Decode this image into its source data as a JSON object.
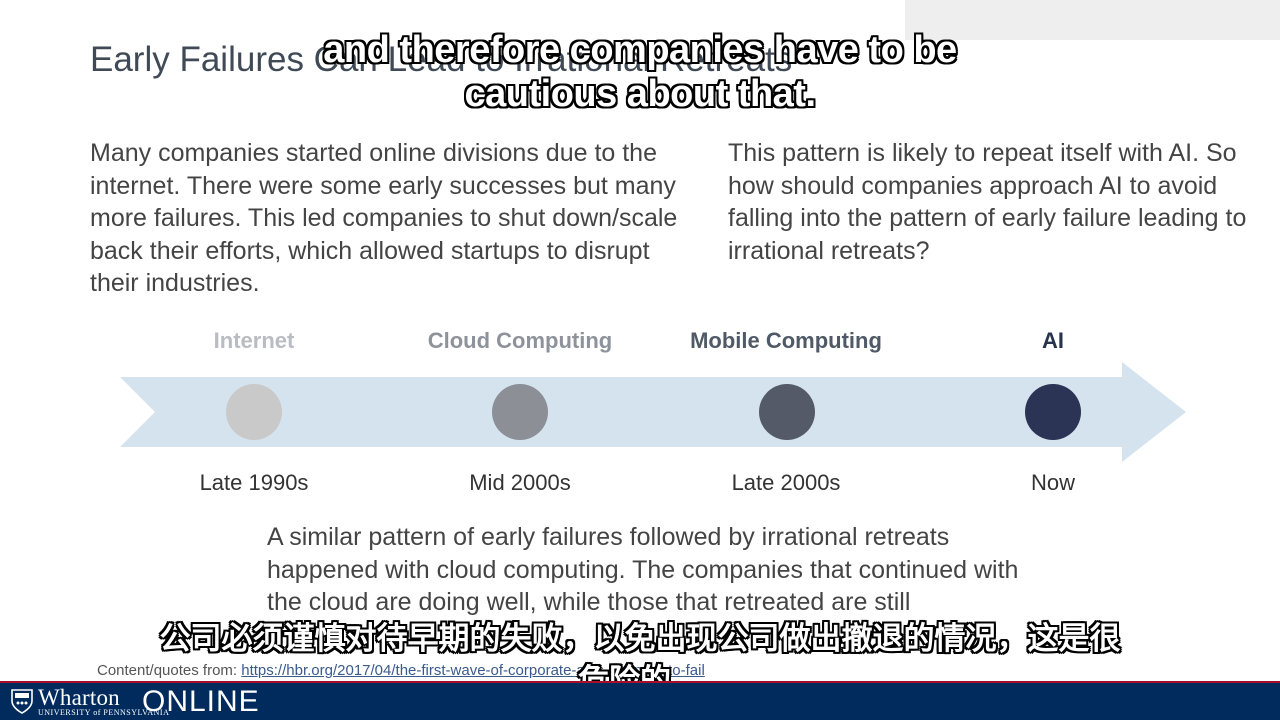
{
  "slide": {
    "title": "Early Failures Can Lead to Irrational Retreats",
    "left_paragraph": "Many companies started online divisions due to the internet. There were some early successes but many more failures. This led companies to shut down/scale back their efforts, which allowed startups to disrupt their industries.",
    "right_paragraph": "This pattern is likely to repeat itself with AI. So how should companies approach AI to avoid falling into the pattern of early failure leading to irrational retreats?",
    "bottom_paragraph": "A similar pattern of early failures followed by irrational retreats happened with cloud computing. The companies that continued with the cloud are doing well, while those that retreated are still",
    "source_prefix": "Content/quotes from: ",
    "source_url": "https://hbr.org/2017/04/the-first-wave-of-corporate-ai-is-doomed-to-fail"
  },
  "timeline": {
    "arrow_color": "#d5e3ef",
    "eras": [
      {
        "label": "Internet",
        "date": "Late 1990s",
        "label_color": "#b9bcc2",
        "dot_color": "#c9c9c9"
      },
      {
        "label": "Cloud Computing",
        "date": "Mid 2000s",
        "label_color": "#8e939b",
        "dot_color": "#8c8f96"
      },
      {
        "label": "Mobile Computing",
        "date": "Late 2000s",
        "label_color": "#505a67",
        "dot_color": "#545a68"
      },
      {
        "label": "AI",
        "date": "Now",
        "label_color": "#28344e",
        "dot_color": "#2b3454"
      }
    ]
  },
  "captions": {
    "english": "and therefore companies have to be cautious about that.",
    "chinese": "公司必须谨慎对待早期的失败，以免出现公司做出撤退的情况，这是很危险的。"
  },
  "footer": {
    "brand": "Wharton",
    "university": "UNIVERSITY of PENNSYLVANIA",
    "product": "ONLINE",
    "bar_color": "#012b5c",
    "rule_color": "#a50f2d"
  }
}
